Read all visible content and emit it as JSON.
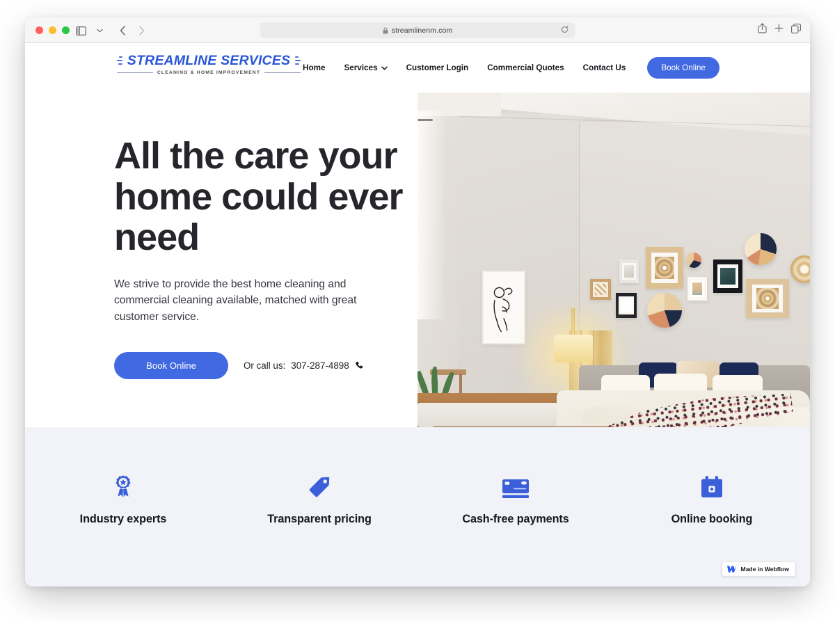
{
  "browser": {
    "url": "streamlinenm.com",
    "lock_icon": "lock-icon",
    "reload_icon": "reload-icon",
    "sidebar_icon": "sidebar-toggle-icon",
    "back_icon": "back-arrow-icon",
    "forward_icon": "forward-arrow-icon",
    "share_icon": "share-icon",
    "new_tab_icon": "plus-icon",
    "tabs_icon": "tab-overview-icon",
    "traffic_lights": [
      "close",
      "minimize",
      "maximize"
    ]
  },
  "site": {
    "logo": {
      "name": "STREAMLINE SERVICES",
      "tagline": "CLEANING & HOME IMPROVEMENT",
      "color": "#2a56d6"
    },
    "nav": {
      "items": [
        {
          "label": "Home",
          "has_dropdown": false
        },
        {
          "label": "Services",
          "has_dropdown": true,
          "icon": "chevron-down-icon"
        },
        {
          "label": "Customer Login",
          "has_dropdown": false
        },
        {
          "label": "Commercial Quotes",
          "has_dropdown": false
        },
        {
          "label": "Contact Us",
          "has_dropdown": false
        }
      ],
      "cta_label": "Book Online"
    }
  },
  "hero": {
    "title": "All the care your home could ever need",
    "subtitle": "We strive to provide the best home cleaning and commercial cleaning available, matched with great customer service.",
    "cta_label": "Book Online",
    "phone_prefix": "Or call us: ",
    "phone_number": "307-287-4898",
    "phone_icon": "phone-icon",
    "image_alt": "bedroom-interior-photo"
  },
  "features": {
    "items": [
      {
        "label": "Industry experts",
        "icon": "award-ribbon-icon"
      },
      {
        "label": "Transparent pricing",
        "icon": "price-tag-icon"
      },
      {
        "label": "Cash-free payments",
        "icon": "credit-card-icon"
      },
      {
        "label": "Online booking",
        "icon": "calendar-icon"
      }
    ]
  },
  "badge": {
    "text": "Made in Webflow",
    "icon": "webflow-logo-icon"
  },
  "colors": {
    "accent": "#4169e1",
    "brand": "#2a56d6",
    "band_bg": "#f2f3f8",
    "text": "#16181d"
  }
}
